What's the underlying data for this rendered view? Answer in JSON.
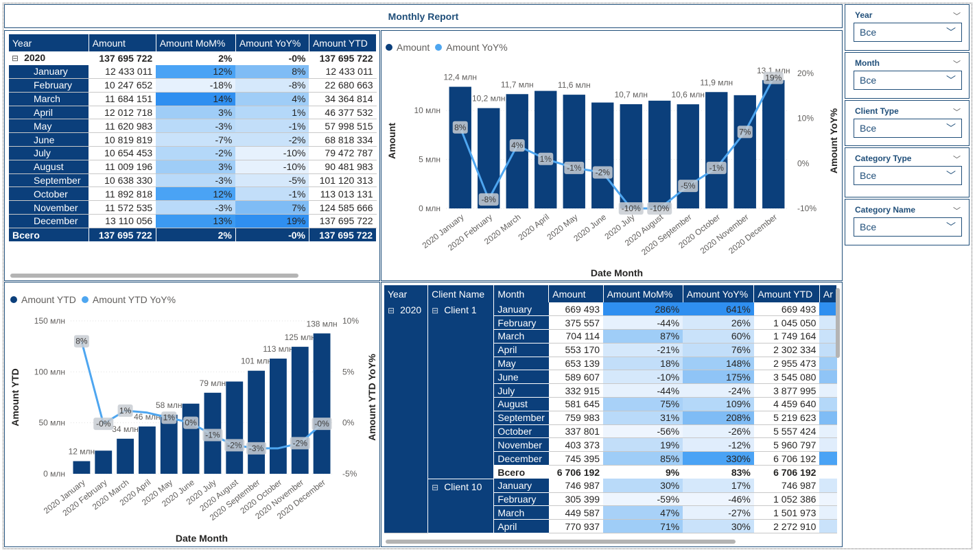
{
  "report_title": "Monthly Report",
  "colors": {
    "navy": "#0b3f7b",
    "light_blue": "#4ea6f0",
    "border": "#1f4e79"
  },
  "table1": {
    "headers": [
      "Year",
      "Amount",
      "Amount MoM%",
      "Amount YoY%",
      "Amount YTD"
    ],
    "year_row": {
      "expander": "⊟",
      "year": "2020",
      "amount": "137 695 722",
      "mom": "2%",
      "yoy": "-0%",
      "ytd": "137 695 722"
    },
    "rows": [
      {
        "month": "January",
        "amount": "12 433 011",
        "mom": "12%",
        "yoy": "8%",
        "ytd": "12 433 011",
        "mom_c": "#4aa3f5",
        "yoy_c": "#7fbcf5"
      },
      {
        "month": "February",
        "amount": "10 247 652",
        "mom": "-18%",
        "yoy": "-8%",
        "ytd": "22 680 663",
        "mom_c": "#e6f1fd",
        "yoy_c": "#d5e8fb"
      },
      {
        "month": "March",
        "amount": "11 684 151",
        "mom": "14%",
        "yoy": "4%",
        "ytd": "34 364 814",
        "mom_c": "#2f8ff0",
        "yoy_c": "#9fcdf7"
      },
      {
        "month": "April",
        "amount": "12 012 718",
        "mom": "3%",
        "yoy": "1%",
        "ytd": "46 377 532",
        "mom_c": "#9fcdf7",
        "yoy_c": "#b4d8f9"
      },
      {
        "month": "May",
        "amount": "11 620 983",
        "mom": "-3%",
        "yoy": "-1%",
        "ytd": "57 998 515",
        "mom_c": "#b9daf9",
        "yoy_c": "#c2def9"
      },
      {
        "month": "June",
        "amount": "10 819 819",
        "mom": "-7%",
        "yoy": "-2%",
        "ytd": "68 818 334",
        "mom_c": "#c9e2fa",
        "yoy_c": "#c9e2fa"
      },
      {
        "month": "July",
        "amount": "10 654 453",
        "mom": "-2%",
        "yoy": "-10%",
        "ytd": "79 472 787",
        "mom_c": "#b4d8f9",
        "yoy_c": "#e6f1fd"
      },
      {
        "month": "August",
        "amount": "11 009 196",
        "mom": "3%",
        "yoy": "-10%",
        "ytd": "90 481 983",
        "mom_c": "#9fcdf7",
        "yoy_c": "#e6f1fd"
      },
      {
        "month": "September",
        "amount": "10 638 330",
        "mom": "-3%",
        "yoy": "-5%",
        "ytd": "101 120 313",
        "mom_c": "#b9daf9",
        "yoy_c": "#d5e8fb"
      },
      {
        "month": "October",
        "amount": "11 892 818",
        "mom": "12%",
        "yoy": "-1%",
        "ytd": "113 013 131",
        "mom_c": "#4aa3f5",
        "yoy_c": "#c2def9"
      },
      {
        "month": "November",
        "amount": "11 572 535",
        "mom": "-3%",
        "yoy": "7%",
        "ytd": "124 585 666",
        "mom_c": "#b9daf9",
        "yoy_c": "#7fbcf5"
      },
      {
        "month": "December",
        "amount": "13 110 056",
        "mom": "13%",
        "yoy": "19%",
        "ytd": "137 695 722",
        "mom_c": "#3c9af2",
        "yoy_c": "#2f8ff0"
      }
    ],
    "total": {
      "label": "Всего",
      "amount": "137 695 722",
      "mom": "2%",
      "yoy": "-0%",
      "ytd": "137 695 722"
    }
  },
  "chart_data": [
    {
      "type": "bar",
      "legend": [
        "Amount",
        "Amount YoY%"
      ],
      "xlabel": "Date Month",
      "ylabel": "Amount",
      "y2label": "Amount YoY%",
      "categories": [
        "2020 January",
        "2020 February",
        "2020 March",
        "2020 April",
        "2020 May",
        "2020 June",
        "2020 July",
        "2020 August",
        "2020 September",
        "2020 October",
        "2020 November",
        "2020 December"
      ],
      "y_ticks": [
        "0 млн",
        "5 млн",
        "10 млн"
      ],
      "y2_ticks": [
        "-10%",
        "0%",
        "10%",
        "20%"
      ],
      "ylim": [
        0,
        13.8
      ],
      "y2lim": [
        -10,
        20
      ],
      "series": [
        {
          "name": "Amount",
          "type": "bar",
          "values": [
            12.43,
            10.25,
            11.68,
            12.01,
            11.62,
            10.82,
            10.65,
            11.01,
            10.64,
            11.89,
            11.57,
            13.11
          ],
          "labels": [
            "12,4 млн",
            "10,2 млн",
            "11,7 млн",
            "",
            "11,6 млн",
            "",
            "10,7 млн",
            "",
            "10,6 млн",
            "11,9 млн",
            "",
            "13,1 млн"
          ]
        },
        {
          "name": "Amount YoY%",
          "type": "line",
          "values": [
            8,
            -8,
            4,
            1,
            -1,
            -2,
            -10,
            -10,
            -5,
            -1,
            7,
            19
          ],
          "labels": [
            "8%",
            "-8%",
            "4%",
            "1%",
            "-1%",
            "-2%",
            "-10%",
            "-10%",
            "-5%",
            "-1%",
            "7%",
            "19%"
          ]
        }
      ]
    },
    {
      "type": "bar",
      "legend": [
        "Amount YTD",
        "Amount YTD YoY%"
      ],
      "xlabel": "Date Month",
      "ylabel": "Amount YTD",
      "y2label": "Amount YTD YoY%",
      "categories": [
        "2020 January",
        "2020 February",
        "2020 March",
        "2020 April",
        "2020 May",
        "2020 June",
        "2020 July",
        "2020 August",
        "2020 September",
        "2020 October",
        "2020 November",
        "2020 December"
      ],
      "y_ticks": [
        "0 млн",
        "50 млн",
        "100 млн",
        "150 млн"
      ],
      "y2_ticks": [
        "-5%",
        "0%",
        "5%",
        "10%"
      ],
      "ylim": [
        0,
        150
      ],
      "y2lim": [
        -5,
        10
      ],
      "series": [
        {
          "name": "Amount YTD",
          "type": "bar",
          "values": [
            12.4,
            22.7,
            34.4,
            46.4,
            58.0,
            68.8,
            79.5,
            90.5,
            101.1,
            113.0,
            124.6,
            137.7
          ],
          "labels": [
            "12 млн",
            "",
            "34 млн",
            "46 млн",
            "58 млн",
            "",
            "79 млн",
            "",
            "101 млн",
            "113 млн",
            "125 млн",
            "138 млн"
          ]
        },
        {
          "name": "Amount YTD YoY%",
          "type": "line",
          "values": [
            8,
            -0.1,
            1.2,
            1.0,
            0.5,
            0.0,
            -1.2,
            -2.2,
            -2.5,
            -2.5,
            -2.0,
            -0.1
          ],
          "labels": [
            "8%",
            "-0%",
            "1%",
            "",
            "1%",
            "0%",
            "-1%",
            "-2%",
            "-3%",
            "",
            "-2%",
            "-0%"
          ]
        }
      ]
    }
  ],
  "table2": {
    "headers": [
      "Year",
      "Client Name",
      "Month",
      "Amount",
      "Amount MoM%",
      "Amount YoY%",
      "Amount YTD",
      "Ar"
    ],
    "year": "2020",
    "year_expander": "⊟",
    "clients": [
      {
        "expander": "⊟",
        "name": "Client 1",
        "rows": [
          {
            "month": "January",
            "amount": "669 493",
            "mom": "286%",
            "yoy": "641%",
            "ytd": "669 493",
            "mom_c": "#2f8ff0",
            "yoy_c": "#2f8ff0"
          },
          {
            "month": "February",
            "amount": "375 557",
            "mom": "-44%",
            "yoy": "26%",
            "ytd": "1 045 050",
            "mom_c": "#e6f1fd",
            "yoy_c": "#d5e8fb"
          },
          {
            "month": "March",
            "amount": "704 114",
            "mom": "87%",
            "yoy": "60%",
            "ytd": "1 749 164",
            "mom_c": "#9fcdf7",
            "yoy_c": "#c9e2fa"
          },
          {
            "month": "April",
            "amount": "553 170",
            "mom": "-21%",
            "yoy": "76%",
            "ytd": "2 302 334",
            "mom_c": "#d5e8fb",
            "yoy_c": "#c2def9"
          },
          {
            "month": "May",
            "amount": "653 139",
            "mom": "18%",
            "yoy": "148%",
            "ytd": "2 955 473",
            "mom_c": "#c2def9",
            "yoy_c": "#9fcdf7"
          },
          {
            "month": "June",
            "amount": "589 607",
            "mom": "-10%",
            "yoy": "175%",
            "ytd": "3 545 080",
            "mom_c": "#d5e8fb",
            "yoy_c": "#8fc4f6"
          },
          {
            "month": "July",
            "amount": "332 915",
            "mom": "-44%",
            "yoy": "-24%",
            "ytd": "3 877 995",
            "mom_c": "#e6f1fd",
            "yoy_c": "#e6f1fd"
          },
          {
            "month": "August",
            "amount": "581 645",
            "mom": "75%",
            "yoy": "109%",
            "ytd": "4 459 640",
            "mom_c": "#a8d1f8",
            "yoy_c": "#b4d8f9"
          },
          {
            "month": "September",
            "amount": "759 983",
            "mom": "31%",
            "yoy": "208%",
            "ytd": "5 219 623",
            "mom_c": "#b9daf9",
            "yoy_c": "#7fbcf5"
          },
          {
            "month": "October",
            "amount": "337 801",
            "mom": "-56%",
            "yoy": "-26%",
            "ytd": "5 557 424",
            "mom_c": "#eef5fe",
            "yoy_c": "#e6f1fd"
          },
          {
            "month": "November",
            "amount": "403 373",
            "mom": "19%",
            "yoy": "-12%",
            "ytd": "5 960 797",
            "mom_c": "#c2def9",
            "yoy_c": "#e0edfc"
          },
          {
            "month": "December",
            "amount": "745 395",
            "mom": "85%",
            "yoy": "330%",
            "ytd": "6 706 192",
            "mom_c": "#9fcdf7",
            "yoy_c": "#4aa3f5"
          }
        ],
        "total": {
          "label": "Всего",
          "amount": "6 706 192",
          "mom": "9%",
          "yoy": "83%",
          "ytd": "6 706 192"
        }
      },
      {
        "expander": "⊟",
        "name": "Client 10",
        "rows": [
          {
            "month": "January",
            "amount": "746 987",
            "mom": "30%",
            "yoy": "17%",
            "ytd": "746 987",
            "mom_c": "#b9daf9",
            "yoy_c": "#d5e8fb"
          },
          {
            "month": "February",
            "amount": "305 399",
            "mom": "-59%",
            "yoy": "-46%",
            "ytd": "1 052 386",
            "mom_c": "#eef5fe",
            "yoy_c": "#eef5fe"
          },
          {
            "month": "March",
            "amount": "449 587",
            "mom": "47%",
            "yoy": "-27%",
            "ytd": "1 501 973",
            "mom_c": "#a8d1f8",
            "yoy_c": "#e6f1fd"
          },
          {
            "month": "April",
            "amount": "770 937",
            "mom": "71%",
            "yoy": "30%",
            "ytd": "2 272 910",
            "mom_c": "#9fcdf7",
            "yoy_c": "#c9e2fa"
          }
        ]
      }
    ]
  },
  "slicers": [
    {
      "title": "Year",
      "value": "Все"
    },
    {
      "title": "Month",
      "value": "Все"
    },
    {
      "title": "Client Type",
      "value": "Все"
    },
    {
      "title": "Category Type",
      "value": "Все"
    },
    {
      "title": "Category Name",
      "value": "Все"
    }
  ]
}
